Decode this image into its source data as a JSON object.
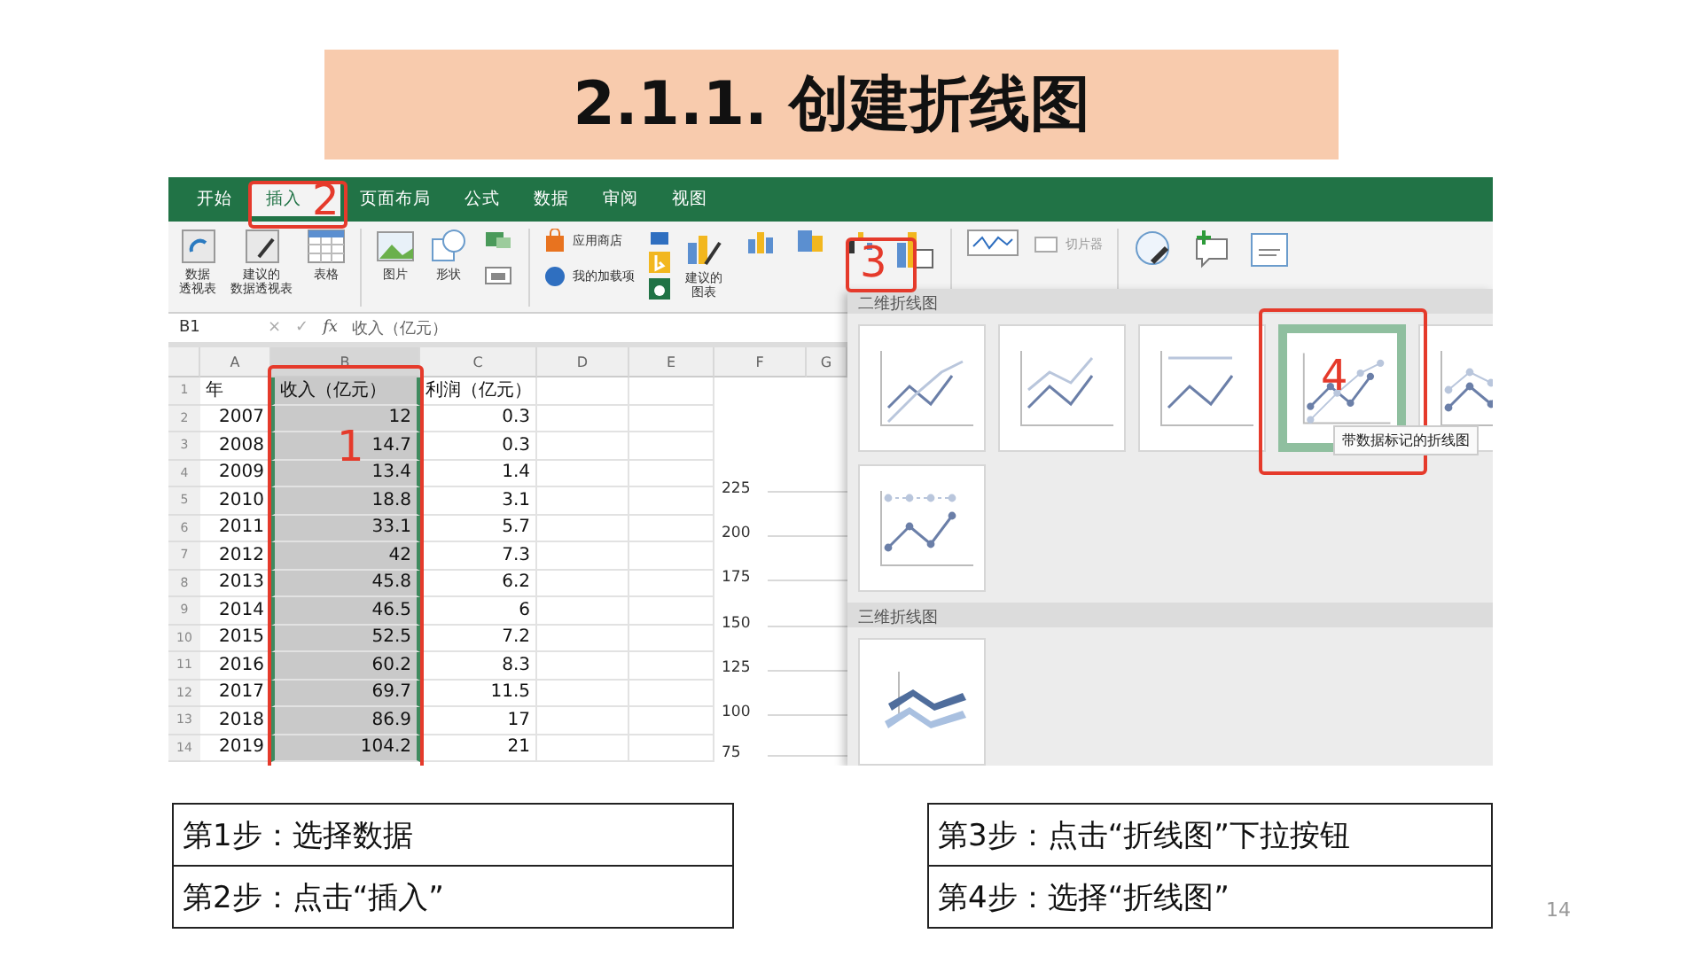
{
  "title": "2.1.1. 创建折线图",
  "excel": {
    "tabs": [
      {
        "label": "开始",
        "selected": false
      },
      {
        "label": "插入",
        "selected": true
      },
      {
        "label": "页面布局",
        "selected": false
      },
      {
        "label": "公式",
        "selected": false
      },
      {
        "label": "数据",
        "selected": false
      },
      {
        "label": "审阅",
        "selected": false
      },
      {
        "label": "视图",
        "selected": false
      }
    ],
    "ribbon": {
      "pivot_table": [
        "数据",
        "透视表"
      ],
      "recommended_pivot": [
        "建议的",
        "数据透视表"
      ],
      "table": "表格",
      "pictures": "图片",
      "shapes": "形状",
      "store": "应用商店",
      "my_addins": "我的加载项",
      "recommended_charts": [
        "建议的",
        "图表"
      ],
      "slicer": "切片器"
    },
    "formula_bar": {
      "cell_ref": "B1",
      "cancel": "×",
      "confirm": "✓",
      "fx": "fx",
      "content": "收入（亿元）"
    },
    "columns": [
      {
        "label": "A",
        "selected": false
      },
      {
        "label": "B",
        "selected": true
      },
      {
        "label": "C",
        "selected": false
      },
      {
        "label": "D",
        "selected": false
      },
      {
        "label": "E",
        "selected": false
      },
      {
        "label": "F",
        "selected": false
      },
      {
        "label": "G",
        "selected": false
      }
    ],
    "rows": [
      {
        "number": "1",
        "cells": [
          "年",
          "收入（亿元）",
          "利润（亿元）"
        ]
      },
      {
        "number": "2",
        "cells": [
          "2007",
          "12",
          "0.3"
        ]
      },
      {
        "number": "3",
        "cells": [
          "2008",
          "14.7",
          "0.3"
        ]
      },
      {
        "number": "4",
        "cells": [
          "2009",
          "13.4",
          "1.4"
        ]
      },
      {
        "number": "5",
        "cells": [
          "2010",
          "18.8",
          "3.1"
        ]
      },
      {
        "number": "6",
        "cells": [
          "2011",
          "33.1",
          "5.7"
        ]
      },
      {
        "number": "7",
        "cells": [
          "2012",
          "42",
          "7.3"
        ]
      },
      {
        "number": "8",
        "cells": [
          "2013",
          "45.8",
          "6.2"
        ]
      },
      {
        "number": "9",
        "cells": [
          "2014",
          "46.5",
          "6"
        ]
      },
      {
        "number": "10",
        "cells": [
          "2015",
          "52.5",
          "7.2"
        ]
      },
      {
        "number": "11",
        "cells": [
          "2016",
          "60.2",
          "8.3"
        ]
      },
      {
        "number": "12",
        "cells": [
          "2017",
          "69.7",
          "11.5"
        ]
      },
      {
        "number": "13",
        "cells": [
          "2018",
          "86.9",
          "17"
        ]
      },
      {
        "number": "14",
        "cells": [
          "2019",
          "104.2",
          "21"
        ]
      }
    ],
    "chart_axis": [
      "225",
      "200",
      "175",
      "150",
      "125",
      "100",
      "75"
    ],
    "gallery": {
      "sections": [
        {
          "title": "二维折线图",
          "thumbnails": [
            {
              "kind": "line",
              "selected": false
            },
            {
              "kind": "stacked-line",
              "selected": false
            },
            {
              "kind": "percent-line",
              "selected": false
            },
            {
              "kind": "line-markers",
              "selected": true
            },
            {
              "kind": "stacked-line-markers",
              "selected": false
            },
            {
              "kind": "percent-line-markers",
              "selected": false
            }
          ]
        },
        {
          "title": "三维折线图",
          "thumbnails": [
            {
              "kind": "line3d",
              "selected": false
            }
          ]
        }
      ],
      "tooltip": "带数据标记的折线图"
    },
    "annotations": [
      "1",
      "2",
      "3",
      "4"
    ]
  },
  "steps": {
    "left": [
      "第1步：选择数据",
      "第2步：点击“插入”"
    ],
    "right": [
      "第3步：点击“折线图”下拉按钮",
      "第4步：选择“折线图”"
    ]
  },
  "page_number": "14"
}
